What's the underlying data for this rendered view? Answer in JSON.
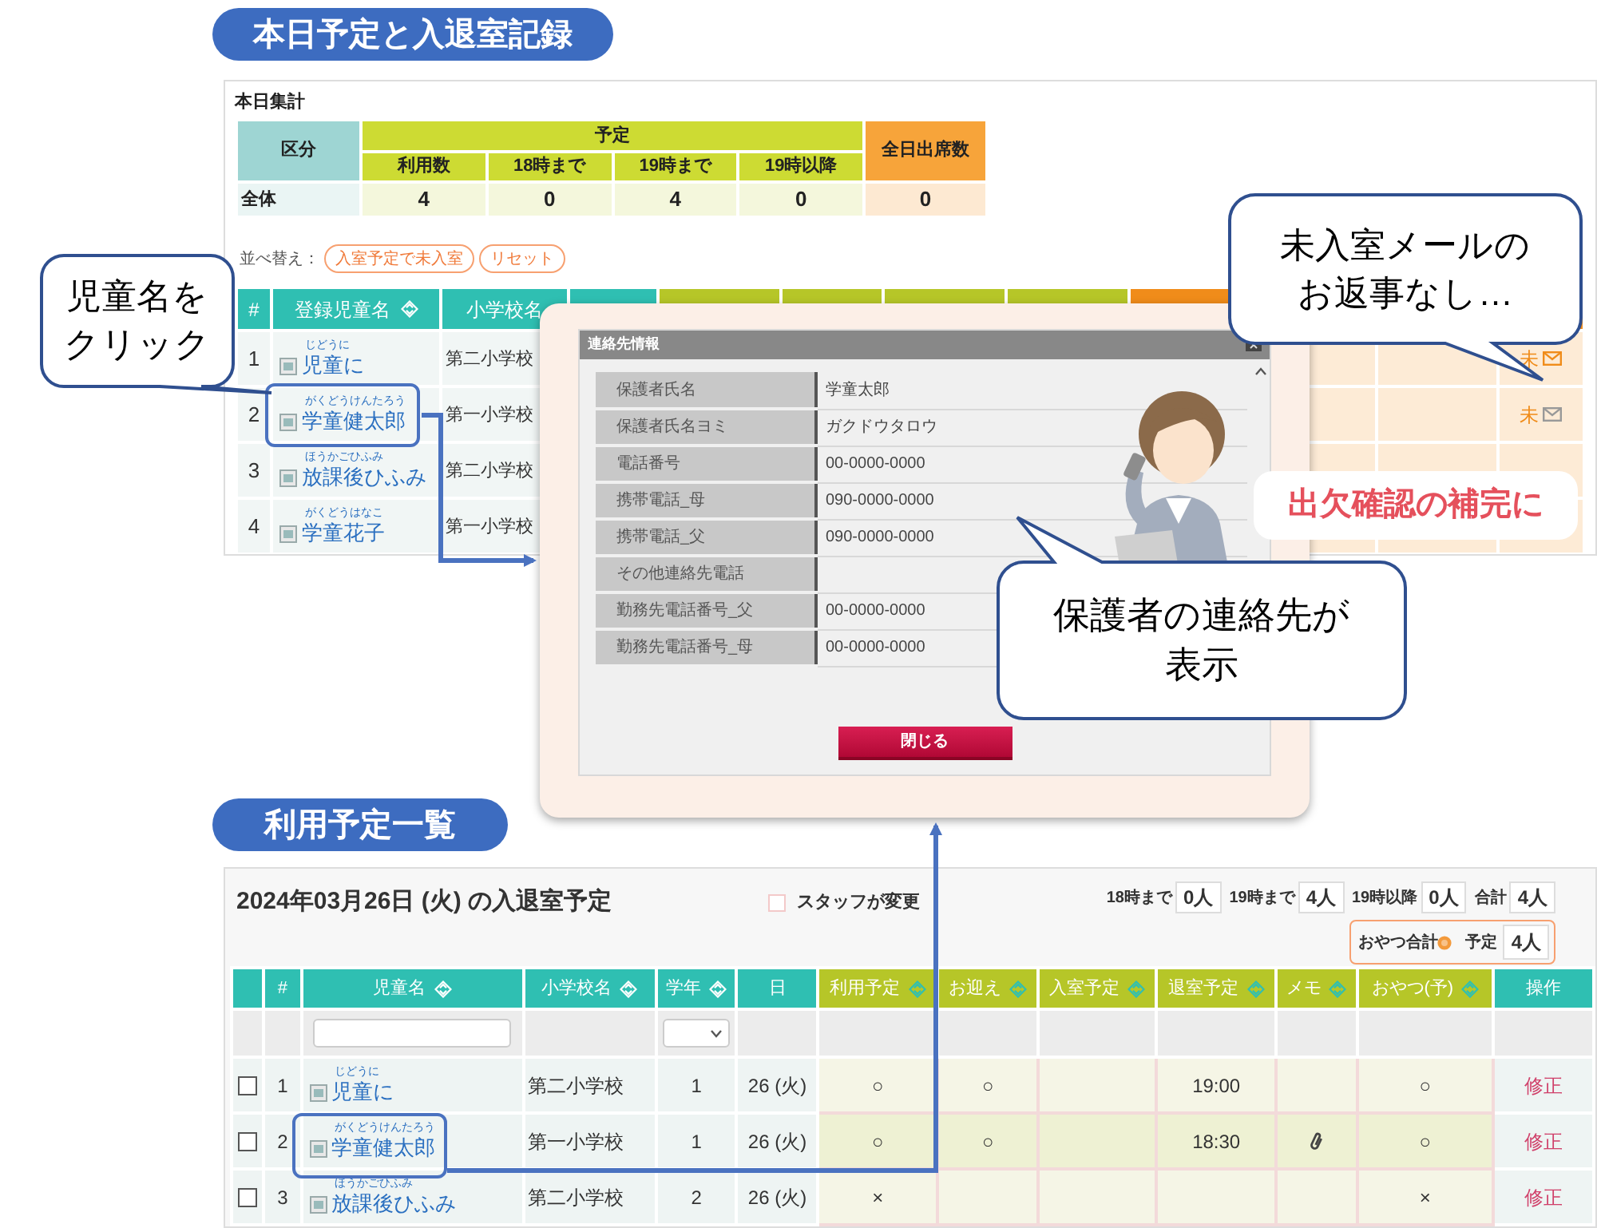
{
  "top_section": {
    "heading": "本日予定と入退室記録",
    "summary": {
      "title": "本日集計",
      "category_header": "区分",
      "plan_header": "予定",
      "plan_columns": [
        "利用数",
        "18時まで",
        "19時まで",
        "19時以降"
      ],
      "attendance_header": "全日出席数",
      "row": {
        "label": "全体",
        "values": [
          "4",
          "0",
          "4",
          "0"
        ],
        "attendance": "0"
      }
    },
    "sort": {
      "label": "並べ替え：",
      "buttons": [
        "入室予定で未入室",
        "リセット"
      ]
    },
    "list": {
      "columns": [
        {
          "label": "#",
          "sortable": false
        },
        {
          "label": "登録児童名",
          "sortable": true
        },
        {
          "label": "小学校名",
          "sortable": false
        }
      ],
      "rows": [
        {
          "no": "1",
          "ruby": "じどうに",
          "name": "児童に",
          "school": "第二小学校",
          "status": "未",
          "mail_highlighted": true,
          "outlined": false
        },
        {
          "no": "2",
          "ruby": "がくどうけんたろう",
          "name": "学童健太郎",
          "school": "第一小学校",
          "status": "未",
          "mail_highlighted": false,
          "outlined": true
        },
        {
          "no": "3",
          "ruby": "ほうかごひふみ",
          "name": "放課後ひふみ",
          "school": "第二小学校",
          "outlined": false
        },
        {
          "no": "4",
          "ruby": "がくどうはなこ",
          "name": "学童花子",
          "school": "第一小学校",
          "outlined": false
        }
      ]
    }
  },
  "contact_dialog": {
    "title": "連絡先情報",
    "fields": [
      {
        "label": "保護者氏名",
        "value": "学童太郎"
      },
      {
        "label": "保護者氏名ヨミ",
        "value": "ガクドウタロウ"
      },
      {
        "label": "電話番号",
        "value": "00-0000-0000"
      },
      {
        "label": "携帯電話_母",
        "value": "090-0000-0000"
      },
      {
        "label": "携帯電話_父",
        "value": "090-0000-0000"
      },
      {
        "label": "その他連絡先電話"
      },
      {
        "label": "勤務先電話番号_父",
        "value": "00-0000-0000"
      },
      {
        "label": "勤務先電話番号_母",
        "value": "00-0000-0000"
      }
    ],
    "button": "閉じる"
  },
  "callouts": [
    {
      "kind": "speech",
      "lines": [
        "児童名を",
        "クリック"
      ]
    },
    {
      "kind": "speech",
      "lines": [
        "未入室メールの",
        "お返事なし…"
      ]
    },
    {
      "kind": "note",
      "lines": [
        "出欠確認の補完に"
      ]
    },
    {
      "kind": "speech",
      "lines": [
        "保護者の連絡先が",
        "表示"
      ]
    }
  ],
  "bottom_section": {
    "heading": "利用予定一覧",
    "title": "2024年03月26日 (火) の入退室予定",
    "staff_checkbox": {
      "label": "スタッフが変更",
      "checked": false
    },
    "counters": [
      {
        "label": "18時まで",
        "value": "0人"
      },
      {
        "label": "19時まで",
        "value": "4人"
      },
      {
        "label": "19時以降",
        "value": "0人"
      },
      {
        "label": "合計",
        "value": "4人"
      }
    ],
    "snack_total": {
      "label": "おやつ合計",
      "sub_label": "予定",
      "value": "4人"
    },
    "columns": [
      {
        "label": "#",
        "kind": "info",
        "sortable": false
      },
      {
        "label": "児童名",
        "kind": "info",
        "sortable": true
      },
      {
        "label": "小学校名",
        "kind": "info",
        "sortable": true
      },
      {
        "label": "学年",
        "kind": "info",
        "sortable": true
      },
      {
        "label": "日",
        "kind": "info",
        "sortable": false
      },
      {
        "label": "利用予定",
        "kind": "plan",
        "sortable": true
      },
      {
        "label": "お迎え",
        "kind": "plan",
        "sortable": true
      },
      {
        "label": "入室予定",
        "kind": "plan",
        "sortable": true
      },
      {
        "label": "退室予定",
        "kind": "plan",
        "sortable": true
      },
      {
        "label": "メモ",
        "kind": "plan",
        "sortable": true
      },
      {
        "label": "おやつ(予)",
        "kind": "plan",
        "sortable": true
      },
      {
        "label": "操作",
        "kind": "info",
        "sortable": false
      }
    ],
    "rows": [
      {
        "checked": false,
        "no": "1",
        "ruby": "じどうに",
        "name": "児童に",
        "school": "第二小学校",
        "grade": "1",
        "day": "26 (火)",
        "plan": "○",
        "pickup": "○",
        "exit": "19:00",
        "memo": false,
        "snack": "○",
        "action": "修正",
        "highlighted": false,
        "outlined": false
      },
      {
        "checked": false,
        "no": "2",
        "ruby": "がくどうけんたろう",
        "name": "学童健太郎",
        "school": "第一小学校",
        "grade": "1",
        "day": "26 (火)",
        "plan": "○",
        "pickup": "○",
        "exit": "18:30",
        "memo": true,
        "snack": "○",
        "action": "修正",
        "highlighted": true,
        "outlined": true
      },
      {
        "checked": false,
        "no": "3",
        "ruby": "ほうかごひふみ",
        "name": "放課後ひふみ",
        "school": "第二小学校",
        "grade": "2",
        "day": "26 (火)",
        "plan": "×",
        "memo": false,
        "snack": "×",
        "action": "修正",
        "highlighted": false,
        "outlined": false
      }
    ]
  }
}
